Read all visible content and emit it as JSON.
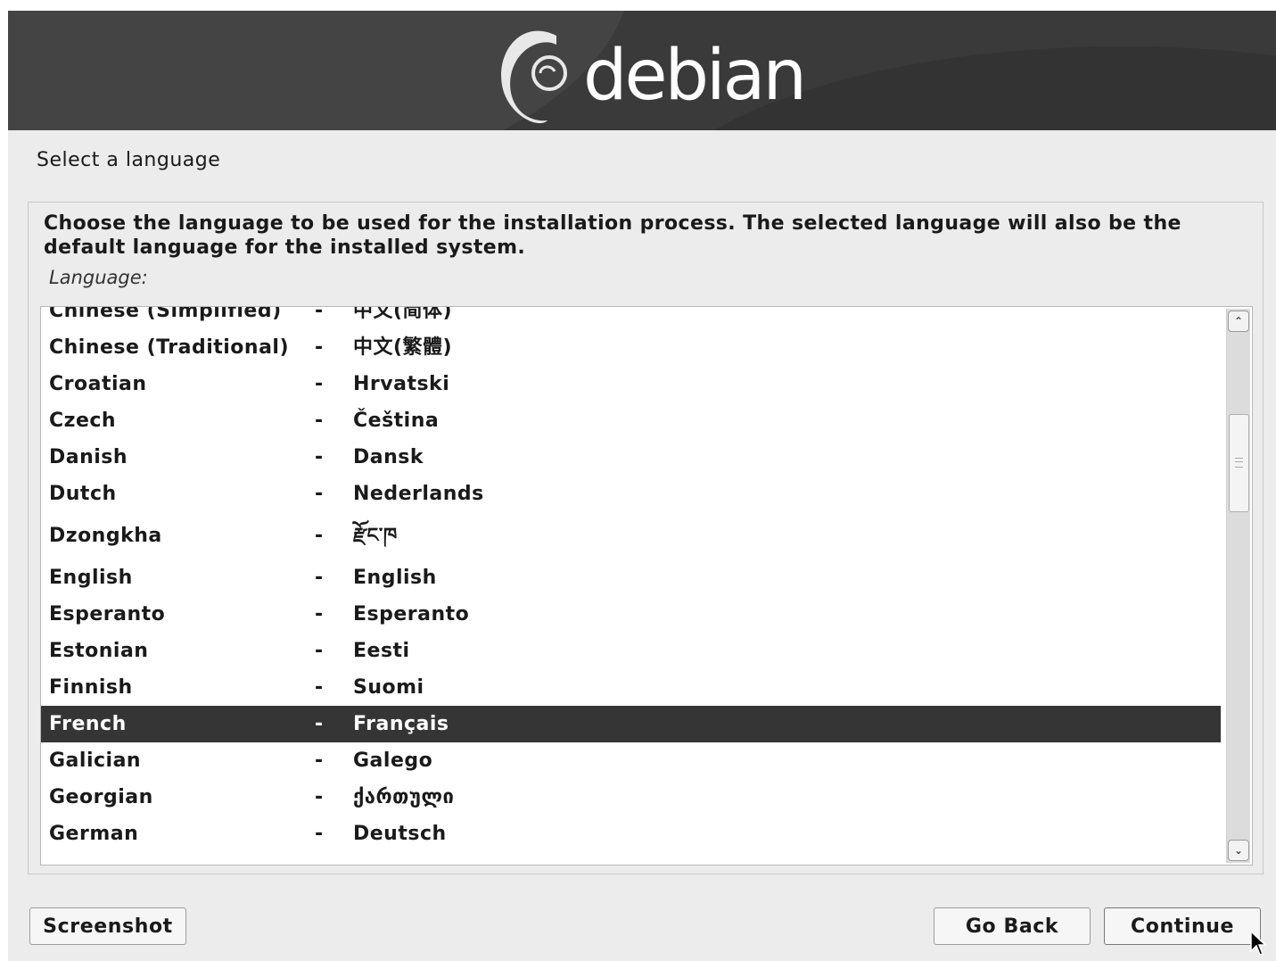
{
  "logo": {
    "text": "debian"
  },
  "page_title": "Select a language",
  "instructions": "Choose the language to be used for the installation process. The selected language will also be the default language for the installed system.",
  "field_label": "Language:",
  "languages": [
    {
      "name": "Chinese (Simplified)",
      "dash": "-",
      "native": "中文(简体)"
    },
    {
      "name": "Chinese (Traditional)",
      "dash": "-",
      "native": "中文(繁體)"
    },
    {
      "name": "Croatian",
      "dash": "-",
      "native": "Hrvatski"
    },
    {
      "name": "Czech",
      "dash": "-",
      "native": "Čeština"
    },
    {
      "name": "Danish",
      "dash": "-",
      "native": "Dansk"
    },
    {
      "name": "Dutch",
      "dash": "-",
      "native": "Nederlands"
    },
    {
      "name": "Dzongkha",
      "dash": "-",
      "native": "རྫོང་ཁ"
    },
    {
      "name": "English",
      "dash": "-",
      "native": "English"
    },
    {
      "name": "Esperanto",
      "dash": "-",
      "native": "Esperanto"
    },
    {
      "name": "Estonian",
      "dash": "-",
      "native": "Eesti"
    },
    {
      "name": "Finnish",
      "dash": "-",
      "native": "Suomi"
    },
    {
      "name": "French",
      "dash": "-",
      "native": "Français"
    },
    {
      "name": "Galician",
      "dash": "-",
      "native": "Galego"
    },
    {
      "name": "Georgian",
      "dash": "-",
      "native": "ქართული"
    },
    {
      "name": "German",
      "dash": "-",
      "native": "Deutsch"
    }
  ],
  "selected_language": "French",
  "scrollbar": {
    "up_icon": "chevron-up-icon",
    "down_icon": "chevron-down-icon"
  },
  "buttons": {
    "screenshot": "Screenshot",
    "go_back": "Go Back",
    "continue": "Continue"
  },
  "colors": {
    "banner": "#3a3a3a",
    "selected_row": "#353535",
    "background": "#ececec"
  }
}
